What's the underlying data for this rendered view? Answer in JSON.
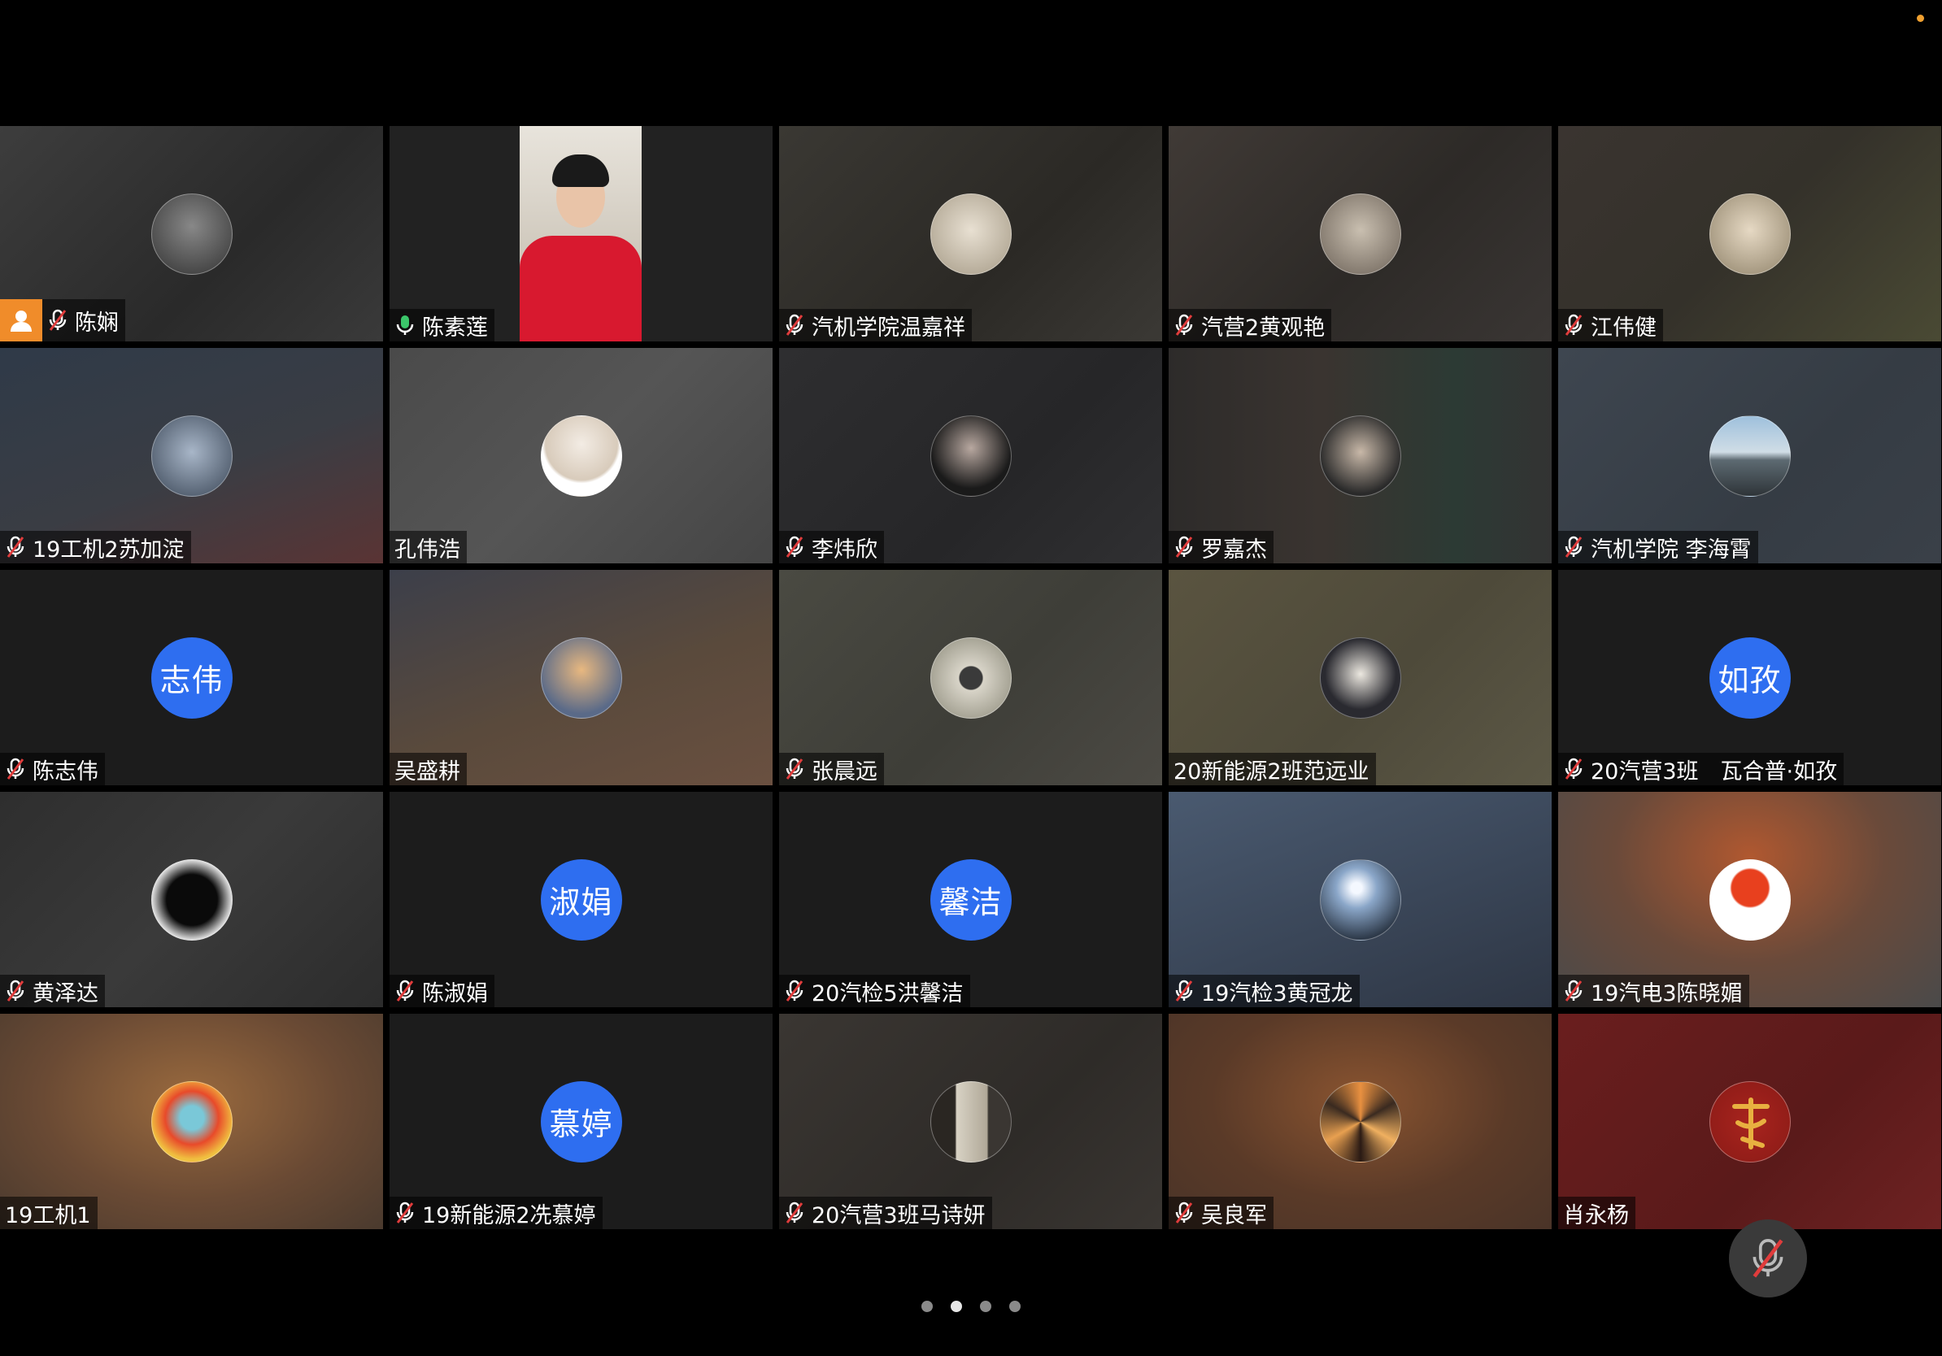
{
  "participants": [
    {
      "name": "陈娴",
      "muted": true,
      "host": true,
      "avatar": "photo-person-icon"
    },
    {
      "name": "陈素莲",
      "muted": false,
      "speaking": true,
      "video": true
    },
    {
      "name": "汽机学院温嘉祥",
      "muted": true,
      "avatar": "photo-figure-icon"
    },
    {
      "name": "汽营2黄观艳",
      "muted": true,
      "avatar": "photo-note-icon"
    },
    {
      "name": "江伟健",
      "muted": true,
      "avatar": "photo-cat-icon"
    },
    {
      "name": "19工机2苏加淀",
      "muted": true,
      "avatar": "photo-anime-icon"
    },
    {
      "name": "孔伟浩",
      "muted": false,
      "avatar": "photo-icecream-icon"
    },
    {
      "name": "李炜欣",
      "muted": true,
      "avatar": "photo-woman-icon"
    },
    {
      "name": "罗嘉杰",
      "muted": true,
      "avatar": "photo-man-icon"
    },
    {
      "name": "汽机学院 李海霄",
      "muted": true,
      "avatar": "photo-beach-icon"
    },
    {
      "name": "陈志伟",
      "muted": true,
      "initials": "志伟"
    },
    {
      "name": "吴盛耕",
      "muted": false,
      "avatar": "photo-sky-icon"
    },
    {
      "name": "张晨远",
      "muted": true,
      "avatar": "photo-stage-icon"
    },
    {
      "name": "20新能源2班范远业",
      "muted": false,
      "avatar": "photo-selfie-icon"
    },
    {
      "name": "20汽营3班　瓦合普·如孜",
      "muted": true,
      "initials": "如孜"
    },
    {
      "name": "黄泽达",
      "muted": true,
      "avatar": "photo-blackcat-icon"
    },
    {
      "name": "陈淑娟",
      "muted": true,
      "initials": "淑娟"
    },
    {
      "name": "20汽检5洪馨洁",
      "muted": true,
      "initials": "馨洁"
    },
    {
      "name": "19汽检3黄冠龙",
      "muted": true,
      "avatar": "photo-moon-icon"
    },
    {
      "name": "19汽电3陈晓媚",
      "muted": true,
      "avatar": "photo-balloon-icon"
    },
    {
      "name": "19工机1",
      "muted": false,
      "avatar": "photo-cartoon-icon"
    },
    {
      "name": "19新能源2冼慕婷",
      "muted": true,
      "initials": "慕婷"
    },
    {
      "name": "20汽营3班马诗妍",
      "muted": true,
      "avatar": "photo-frame-icon"
    },
    {
      "name": "吴良军",
      "muted": true,
      "avatar": "photo-pattern-icon"
    },
    {
      "name": "肖永杨",
      "muted": false,
      "avatar": "photo-calligraphy-icon"
    }
  ],
  "pager": {
    "pages": 4,
    "current": 2
  },
  "colors": {
    "speaking_border": "#3bc66a",
    "initials_bg": "#2e6ef0",
    "host_badge": "#f08c2a"
  }
}
